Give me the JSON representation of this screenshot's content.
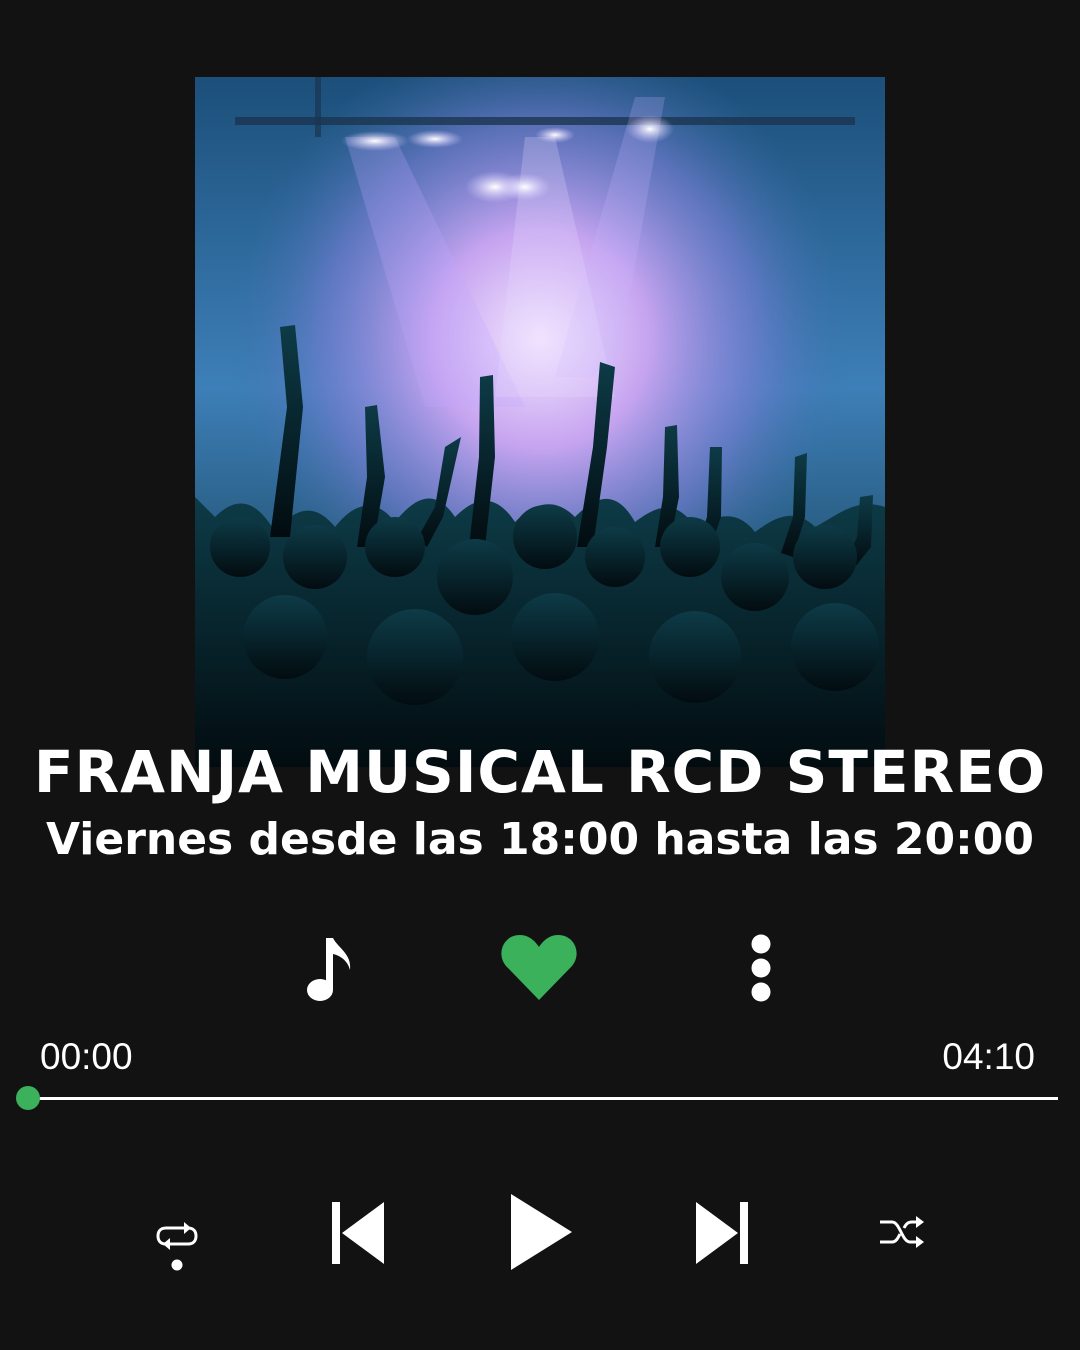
{
  "colors": {
    "background": "#121212",
    "accent": "#3ab15a",
    "text": "#ffffff"
  },
  "cover_image": {
    "description_icon": "concert-crowd-image"
  },
  "track": {
    "title": "FRANJA MUSICAL RCD STEREO",
    "subtitle": "Viernes desde las 18:00 hasta las 20:00"
  },
  "actions": {
    "music_note_icon": "music-note-icon",
    "like_icon": "heart-icon",
    "like_active": true,
    "more_icon": "more-vertical-icon"
  },
  "progress": {
    "elapsed": "00:00",
    "duration": "04:10",
    "fraction": 0
  },
  "controls": {
    "repeat_icon": "repeat-one-icon",
    "previous_icon": "skip-previous-icon",
    "play_icon": "play-icon",
    "next_icon": "skip-next-icon",
    "shuffle_icon": "shuffle-icon"
  }
}
